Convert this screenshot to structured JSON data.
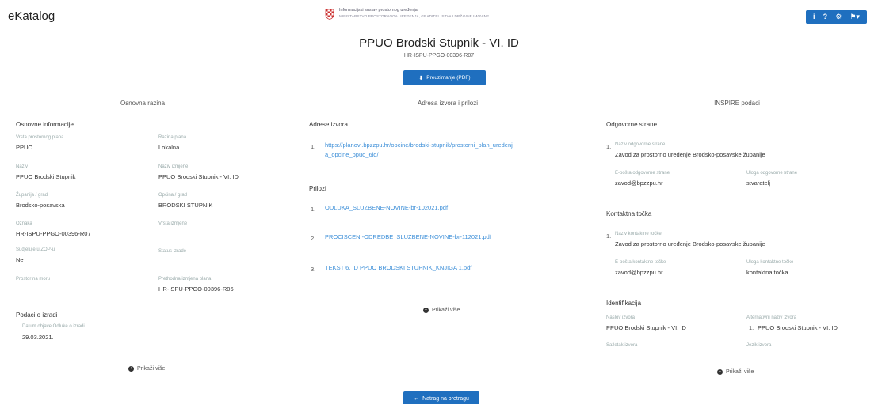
{
  "app": {
    "title": "eKatalog"
  },
  "org": {
    "line1": "Informacijski sustav prostornog uređenja",
    "line2": "MINISTARSTVO PROSTORNOGA UREĐENJA, GRADITELJSTVA I DRŽAVNE IMOVINE"
  },
  "toolbar": {
    "info": "i",
    "help": "?",
    "user": "⚙",
    "lang": "⚑▾"
  },
  "plan": {
    "title": "PPUO Brodski Stupnik - VI. ID",
    "code": "HR-ISPU-PPGO-00396-R07",
    "pdf_label": "Preuzimanje (PDF)"
  },
  "columns": {
    "general": "Osnovna razina",
    "links": "Adresa izvora i prilozi",
    "inspire": "INSPIRE podaci"
  },
  "general": {
    "basic_title": "Osnovne informacije",
    "fields": [
      {
        "label": "Vrsta prostornog plana",
        "value": "PPUO"
      },
      {
        "label": "Razina plana",
        "value": "Lokalna"
      },
      {
        "label": "Naziv",
        "value": "PPUO Brodski Stupnik"
      },
      {
        "label": "Naziv izmjene",
        "value": "PPUO Brodski Stupnik - VI. ID"
      },
      {
        "label": "Županija / grad",
        "value": "Brodsko-posavska"
      },
      {
        "label": "Općina / grad",
        "value": "BRODSKI STUPNIK"
      },
      {
        "label": "Oznaka",
        "value": "HR-ISPU-PPGO-00396-R07"
      },
      {
        "label": "Vrsta izmjene",
        "value": ""
      },
      {
        "label": "Sudjeluje u ZOP-u",
        "value": "Ne"
      },
      {
        "label": "Status izrade",
        "value": ""
      },
      {
        "label": "Prostor na moru",
        "value": ""
      },
      {
        "label": "Prethodna izmjena plana",
        "value": "HR-ISPU-PPGO-00396-R06"
      }
    ],
    "status_title": "Podaci o izradi",
    "status_label": "Datum objave Odluke o izradi",
    "status_value": "29.03.2021.",
    "more": "Prikaži više"
  },
  "links": {
    "sources_title": "Adrese izvora",
    "sources": [
      {
        "num": "1.",
        "text": "https://planovi.bpzzpu.hr/opcine/brodski-stupnik/prostorni_plan_uredenja_opcine_ppuo_6id/"
      }
    ],
    "attachments_title": "Prilozi",
    "attachments": [
      {
        "num": "1.",
        "text": "ODLUKA_SLUZBENE-NOVINE-br-102021.pdf"
      },
      {
        "num": "2.",
        "text": "PROCISCENI-ODREDBE_SLUZBENE-NOVINE-br-112021.pdf"
      },
      {
        "num": "3.",
        "text": "TEKST 6. ID PPUO BRODSKI STUPNIK_KNJIGA 1.pdf"
      }
    ],
    "more": "Prikaži više"
  },
  "inspire": {
    "responsible_title": "Odgovorne strane",
    "responsible": {
      "num": "1.",
      "name_label": "Naziv odgovorne strane",
      "name": "Zavod za prostorno uređenje Brodsko-posavske županije",
      "email_label": "E-pošta odgovorne strane",
      "email": "zavod@bpzzpu.hr",
      "role_label": "Uloga odgovorne strane",
      "role": "stvaratelj"
    },
    "contact_title": "Kontaktna točka",
    "contact": {
      "num": "1.",
      "name_label": "Naziv kontaktne točke",
      "name": "Zavod za prostorno uređenje Brodsko-posavske županije",
      "email_label": "E-pošta kontaktne točke",
      "email": "zavod@bpzzpu.hr",
      "role_label": "Uloga kontaktne točke",
      "role": "kontaktna točka"
    },
    "ident_title": "Identifikacija",
    "ident": {
      "title_label": "Naslov izvora",
      "title": "PPUO Brodski Stupnik - VI. ID",
      "alt_label": "Alternativni naziv izvora",
      "alt_num": "1.",
      "alt": "PPUO Brodski Stupnik - VI. ID",
      "extra_label1": "Sažetak izvora",
      "extra_label2": "Jezik izvora"
    },
    "more": "Prikaži više"
  },
  "footer": {
    "back_label": "Natrag na pretragu"
  }
}
